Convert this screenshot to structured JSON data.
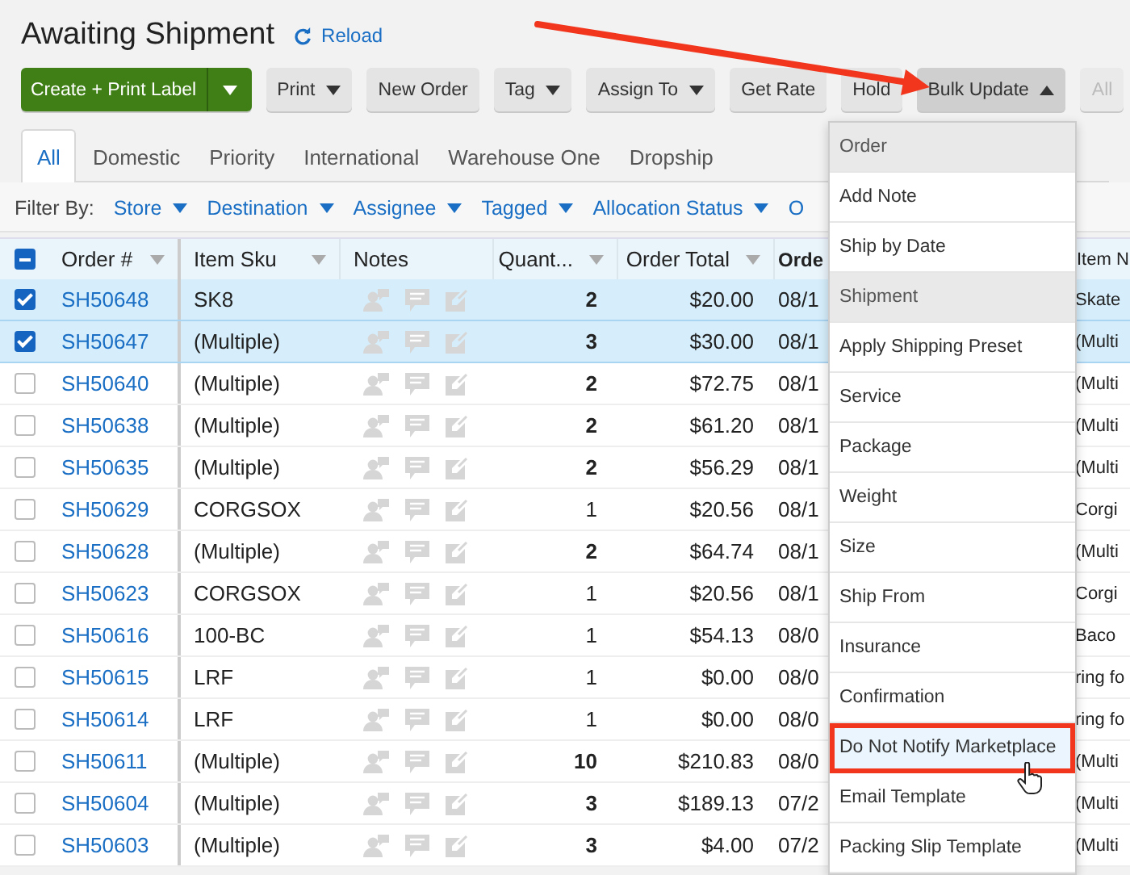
{
  "page": {
    "title": "Awaiting Shipment",
    "reload": "Reload"
  },
  "toolbar": [
    {
      "label": "Create + Print Label",
      "kind": "split",
      "open": false,
      "disabled": false
    },
    {
      "label": "Print",
      "kind": "dropdown",
      "open": false,
      "disabled": false
    },
    {
      "label": "New Order",
      "kind": "plain",
      "open": false,
      "disabled": false
    },
    {
      "label": "Tag",
      "kind": "dropdown",
      "open": false,
      "disabled": false
    },
    {
      "label": "Assign To",
      "kind": "dropdown",
      "open": false,
      "disabled": false
    },
    {
      "label": "Get Rate",
      "kind": "plain",
      "open": false,
      "disabled": false
    },
    {
      "label": "Hold",
      "kind": "plain",
      "open": false,
      "disabled": false
    },
    {
      "label": "Bulk Update",
      "kind": "dropdown",
      "open": true,
      "disabled": false
    },
    {
      "label": "All",
      "kind": "plain",
      "open": false,
      "disabled": true
    }
  ],
  "tabs": [
    {
      "label": "All",
      "selected": true
    },
    {
      "label": "Domestic",
      "selected": false
    },
    {
      "label": "Priority",
      "selected": false
    },
    {
      "label": "International",
      "selected": false
    },
    {
      "label": "Warehouse One",
      "selected": false
    },
    {
      "label": "Dropship",
      "selected": false
    }
  ],
  "filter_bar": {
    "label": "Filter By:",
    "filters": [
      {
        "label": "Store",
        "caret": true
      },
      {
        "label": "Destination",
        "caret": true
      },
      {
        "label": "Assignee",
        "caret": true
      },
      {
        "label": "Tagged",
        "caret": true
      },
      {
        "label": "Allocation Status",
        "caret": true
      },
      {
        "label": "O",
        "caret": false
      }
    ]
  },
  "table": {
    "select_all": {
      "indeterminate": true
    },
    "columns": [
      {
        "label": "Order #",
        "menu": true,
        "sorted": false,
        "kind": "text"
      },
      {
        "label": "Item Sku",
        "menu": true,
        "sorted": false,
        "kind": "text"
      },
      {
        "label": "Notes",
        "menu": false,
        "sorted": false,
        "kind": "text"
      },
      {
        "label": "Quant...",
        "menu": true,
        "sorted": false,
        "kind": "number"
      },
      {
        "label": "Order Total",
        "menu": true,
        "sorted": false,
        "kind": "number"
      },
      {
        "label": "Orde",
        "menu": false,
        "sorted": true,
        "kind": "text"
      },
      {
        "label": "Item N",
        "menu": false,
        "sorted": false,
        "kind": "text"
      }
    ],
    "rows": [
      {
        "selected": true,
        "order": "SH50648",
        "sku": "SK8",
        "quantity": "2",
        "emphasized": true,
        "total": "$20.00",
        "date": "08/1",
        "item_name": "Skate"
      },
      {
        "selected": true,
        "order": "SH50647",
        "sku": "(Multiple)",
        "quantity": "3",
        "emphasized": true,
        "total": "$30.00",
        "date": "08/1",
        "item_name": "(Multi"
      },
      {
        "selected": false,
        "order": "SH50640",
        "sku": "(Multiple)",
        "quantity": "2",
        "emphasized": true,
        "total": "$72.75",
        "date": "08/1",
        "item_name": "(Multi"
      },
      {
        "selected": false,
        "order": "SH50638",
        "sku": "(Multiple)",
        "quantity": "2",
        "emphasized": true,
        "total": "$61.20",
        "date": "08/1",
        "item_name": "(Multi"
      },
      {
        "selected": false,
        "order": "SH50635",
        "sku": "(Multiple)",
        "quantity": "2",
        "emphasized": true,
        "total": "$56.29",
        "date": "08/1",
        "item_name": "(Multi"
      },
      {
        "selected": false,
        "order": "SH50629",
        "sku": "CORGSOX",
        "quantity": "1",
        "emphasized": false,
        "total": "$20.56",
        "date": "08/1",
        "item_name": "Corgi"
      },
      {
        "selected": false,
        "order": "SH50628",
        "sku": "(Multiple)",
        "quantity": "2",
        "emphasized": true,
        "total": "$64.74",
        "date": "08/1",
        "item_name": "(Multi"
      },
      {
        "selected": false,
        "order": "SH50623",
        "sku": "CORGSOX",
        "quantity": "1",
        "emphasized": false,
        "total": "$20.56",
        "date": "08/1",
        "item_name": "Corgi"
      },
      {
        "selected": false,
        "order": "SH50616",
        "sku": "100-BC",
        "quantity": "1",
        "emphasized": false,
        "total": "$54.13",
        "date": "08/0",
        "item_name": "Baco"
      },
      {
        "selected": false,
        "order": "SH50615",
        "sku": "LRF",
        "quantity": "1",
        "emphasized": false,
        "total": "$0.00",
        "date": "08/0",
        "item_name": "ring fo"
      },
      {
        "selected": false,
        "order": "SH50614",
        "sku": "LRF",
        "quantity": "1",
        "emphasized": false,
        "total": "$0.00",
        "date": "08/0",
        "item_name": "ring fo"
      },
      {
        "selected": false,
        "order": "SH50611",
        "sku": "(Multiple)",
        "quantity": "10",
        "emphasized": true,
        "total": "$210.83",
        "date": "08/0",
        "item_name": "(Multi"
      },
      {
        "selected": false,
        "order": "SH50604",
        "sku": "(Multiple)",
        "quantity": "3",
        "emphasized": true,
        "total": "$189.13",
        "date": "07/2",
        "item_name": "(Multi"
      },
      {
        "selected": false,
        "order": "SH50603",
        "sku": "(Multiple)",
        "quantity": "3",
        "emphasized": true,
        "total": "$4.00",
        "date": "07/2",
        "item_name": "(Multi"
      }
    ]
  },
  "bulk_update_menu": [
    {
      "label": "Order",
      "kind": "header",
      "hovered": false,
      "highlighted": false
    },
    {
      "label": "Add Note",
      "kind": "item",
      "hovered": false,
      "highlighted": false
    },
    {
      "label": "Ship by Date",
      "kind": "item",
      "hovered": false,
      "highlighted": false
    },
    {
      "label": "Shipment",
      "kind": "header",
      "hovered": false,
      "highlighted": false
    },
    {
      "label": "Apply Shipping Preset",
      "kind": "item",
      "hovered": false,
      "highlighted": false
    },
    {
      "label": "Service",
      "kind": "item",
      "hovered": false,
      "highlighted": false
    },
    {
      "label": "Package",
      "kind": "item",
      "hovered": false,
      "highlighted": false
    },
    {
      "label": "Weight",
      "kind": "item",
      "hovered": false,
      "highlighted": false
    },
    {
      "label": "Size",
      "kind": "item",
      "hovered": false,
      "highlighted": false
    },
    {
      "label": "Ship From",
      "kind": "item",
      "hovered": false,
      "highlighted": false
    },
    {
      "label": "Insurance",
      "kind": "item",
      "hovered": false,
      "highlighted": false
    },
    {
      "label": "Confirmation",
      "kind": "item",
      "hovered": false,
      "highlighted": false
    },
    {
      "label": "Do Not Notify Marketplace",
      "kind": "item",
      "hovered": true,
      "highlighted": true
    },
    {
      "label": "Email Template",
      "kind": "item",
      "hovered": false,
      "highlighted": false
    },
    {
      "label": "Packing Slip Template",
      "kind": "item",
      "hovered": false,
      "highlighted": false
    }
  ]
}
